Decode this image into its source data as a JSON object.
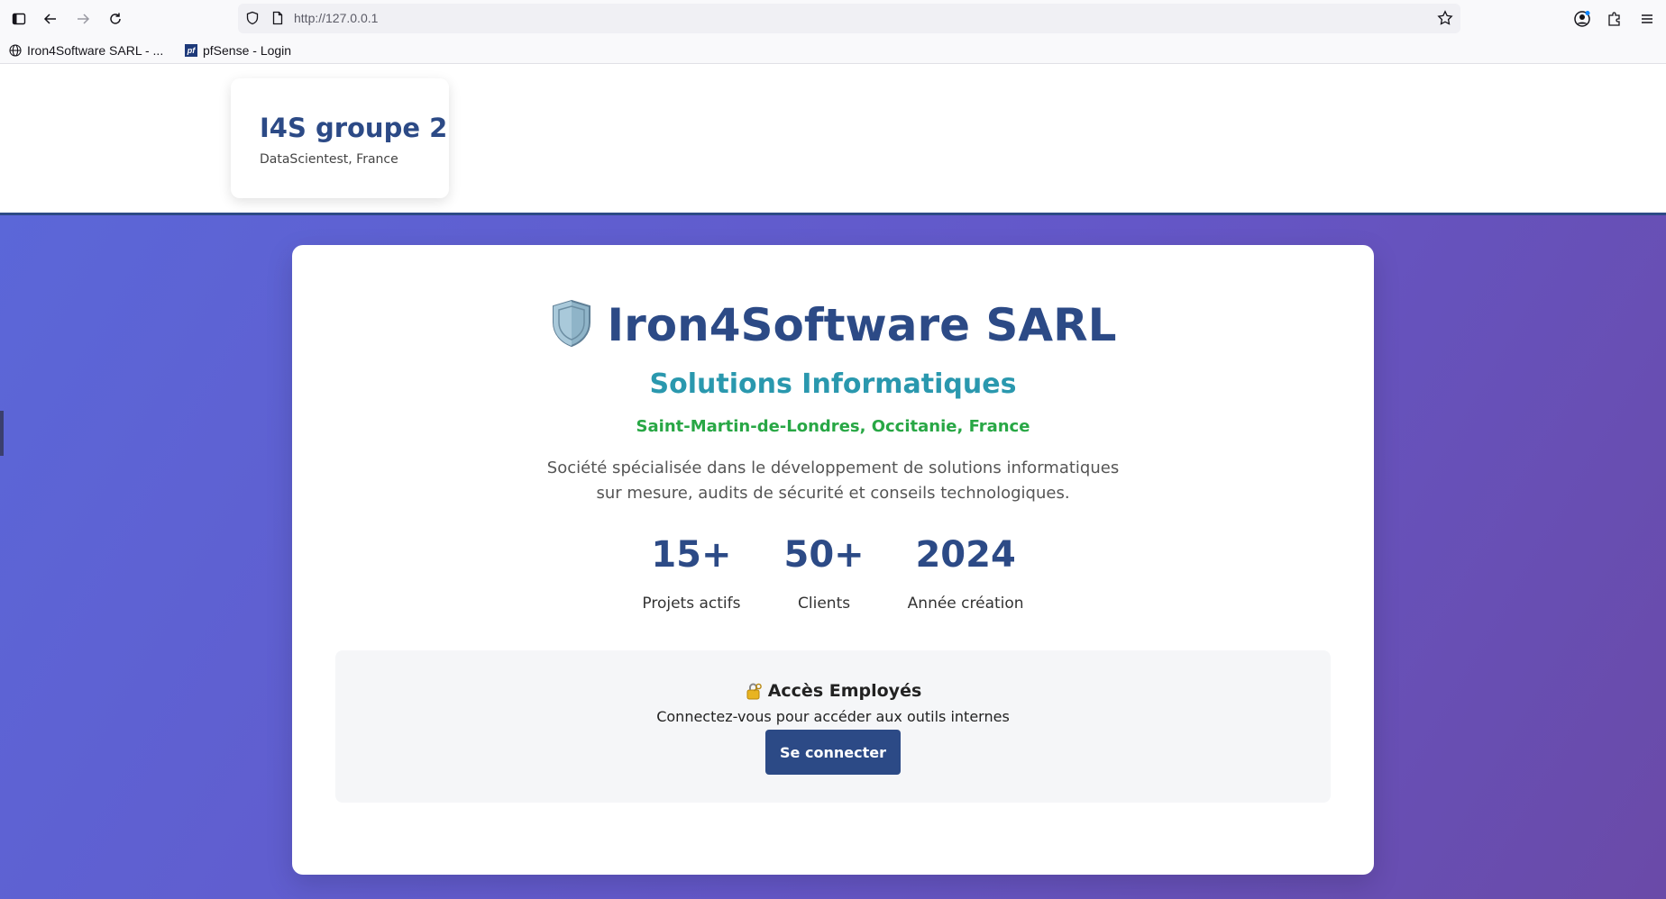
{
  "browser": {
    "url": "http://127.0.0.1",
    "bookmarks": [
      {
        "label": "Iron4Software SARL - ..."
      },
      {
        "label": "pfSense - Login",
        "icon_text": "pf"
      }
    ]
  },
  "header": {
    "title": "I4S groupe 2",
    "subtitle": "DataScientest, France"
  },
  "hero": {
    "icon": "shield-icon",
    "title": "Iron4Software SARL",
    "subtitle": "Solutions Informatiques",
    "location": "Saint-Martin-de-Londres, Occitanie, France",
    "description_line1": "Société spécialisée dans le développement de solutions informatiques",
    "description_line2": "sur mesure, audits de sécurité et conseils technologiques."
  },
  "stats": [
    {
      "value": "15+",
      "label": "Projets actifs"
    },
    {
      "value": "50+",
      "label": "Clients"
    },
    {
      "value": "2024",
      "label": "Année création"
    }
  ],
  "access": {
    "icon": "lock-icon",
    "title": "Accès Employés",
    "subtitle": "Connectez-vous pour accéder aux outils internes",
    "button_label": "Se connecter"
  },
  "colors": {
    "primary": "#2c4a86",
    "teal": "#2a98ae",
    "green": "#28a745",
    "gradient_start": "#5b67d8",
    "gradient_end": "#6a4aa8"
  }
}
